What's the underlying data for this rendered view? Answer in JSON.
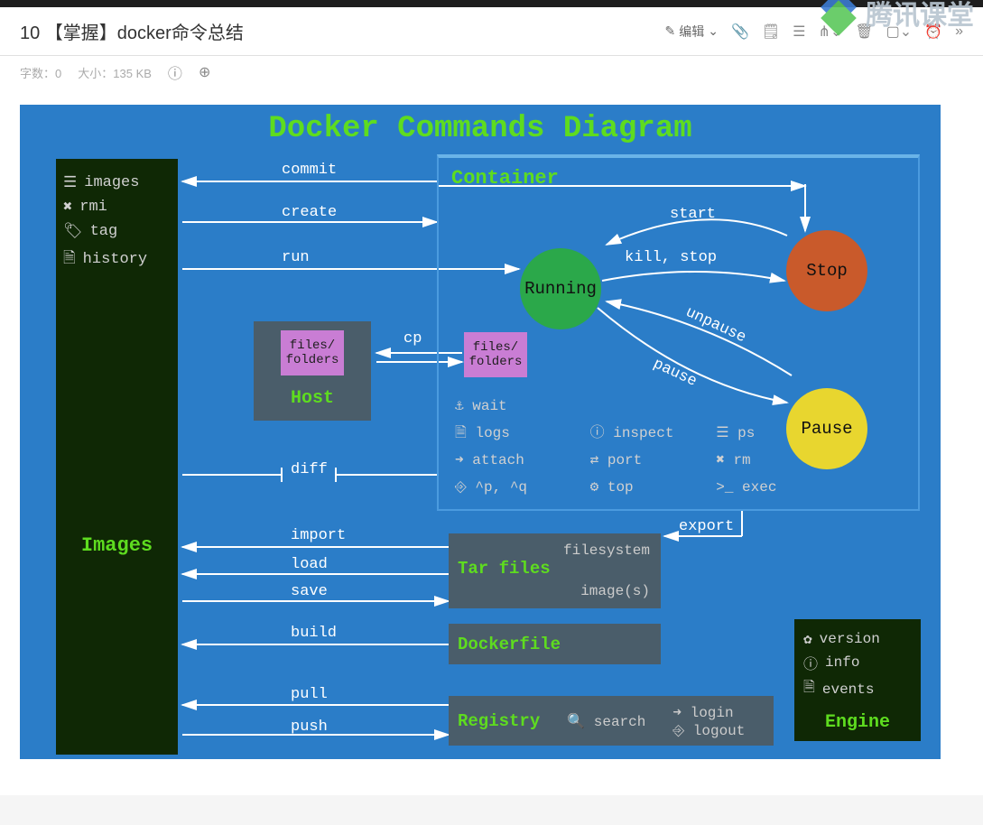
{
  "header": {
    "title": "10 【掌握】docker命令总结",
    "edit_label": "编辑"
  },
  "meta": {
    "words_label": "字数：",
    "words": "0",
    "size_label": "大小：",
    "size": "135 KB"
  },
  "watermark": "腾讯课堂",
  "diagram": {
    "title": "Docker Commands Diagram",
    "images_panel": {
      "rows": [
        "images",
        "rmi",
        "tag",
        "history"
      ],
      "label": "Images"
    },
    "container": {
      "label": "Container",
      "states": {
        "running": "Running",
        "stop": "Stop",
        "pause": "Pause"
      },
      "transitions": {
        "start": "start",
        "kill_stop": "kill, stop",
        "pause": "pause",
        "unpause": "unpause",
        "run": "run",
        "commit": "commit",
        "create": "create",
        "cp": "cp",
        "diff": "diff"
      },
      "cmds_col1": [
        "wait",
        "logs",
        "attach",
        "^p, ^q"
      ],
      "cmds_col2": [
        "inspect",
        "port",
        "top"
      ],
      "cmds_col3": [
        "ps",
        "rm",
        "exec"
      ]
    },
    "host": {
      "label": "Host",
      "files": "files/\nfolders"
    },
    "container_files": "files/\nfolders",
    "tar": {
      "label": "Tar files",
      "filesystem": "filesystem",
      "images": "image(s)",
      "import": "import",
      "load": "load",
      "save": "save",
      "export": "export"
    },
    "dockerfile": {
      "label": "Dockerfile",
      "build": "build"
    },
    "registry": {
      "label": "Registry",
      "search": "search",
      "login": "login",
      "logout": "logout",
      "pull": "pull",
      "push": "push"
    },
    "engine": {
      "label": "Engine",
      "rows": [
        "version",
        "info",
        "events"
      ]
    }
  }
}
